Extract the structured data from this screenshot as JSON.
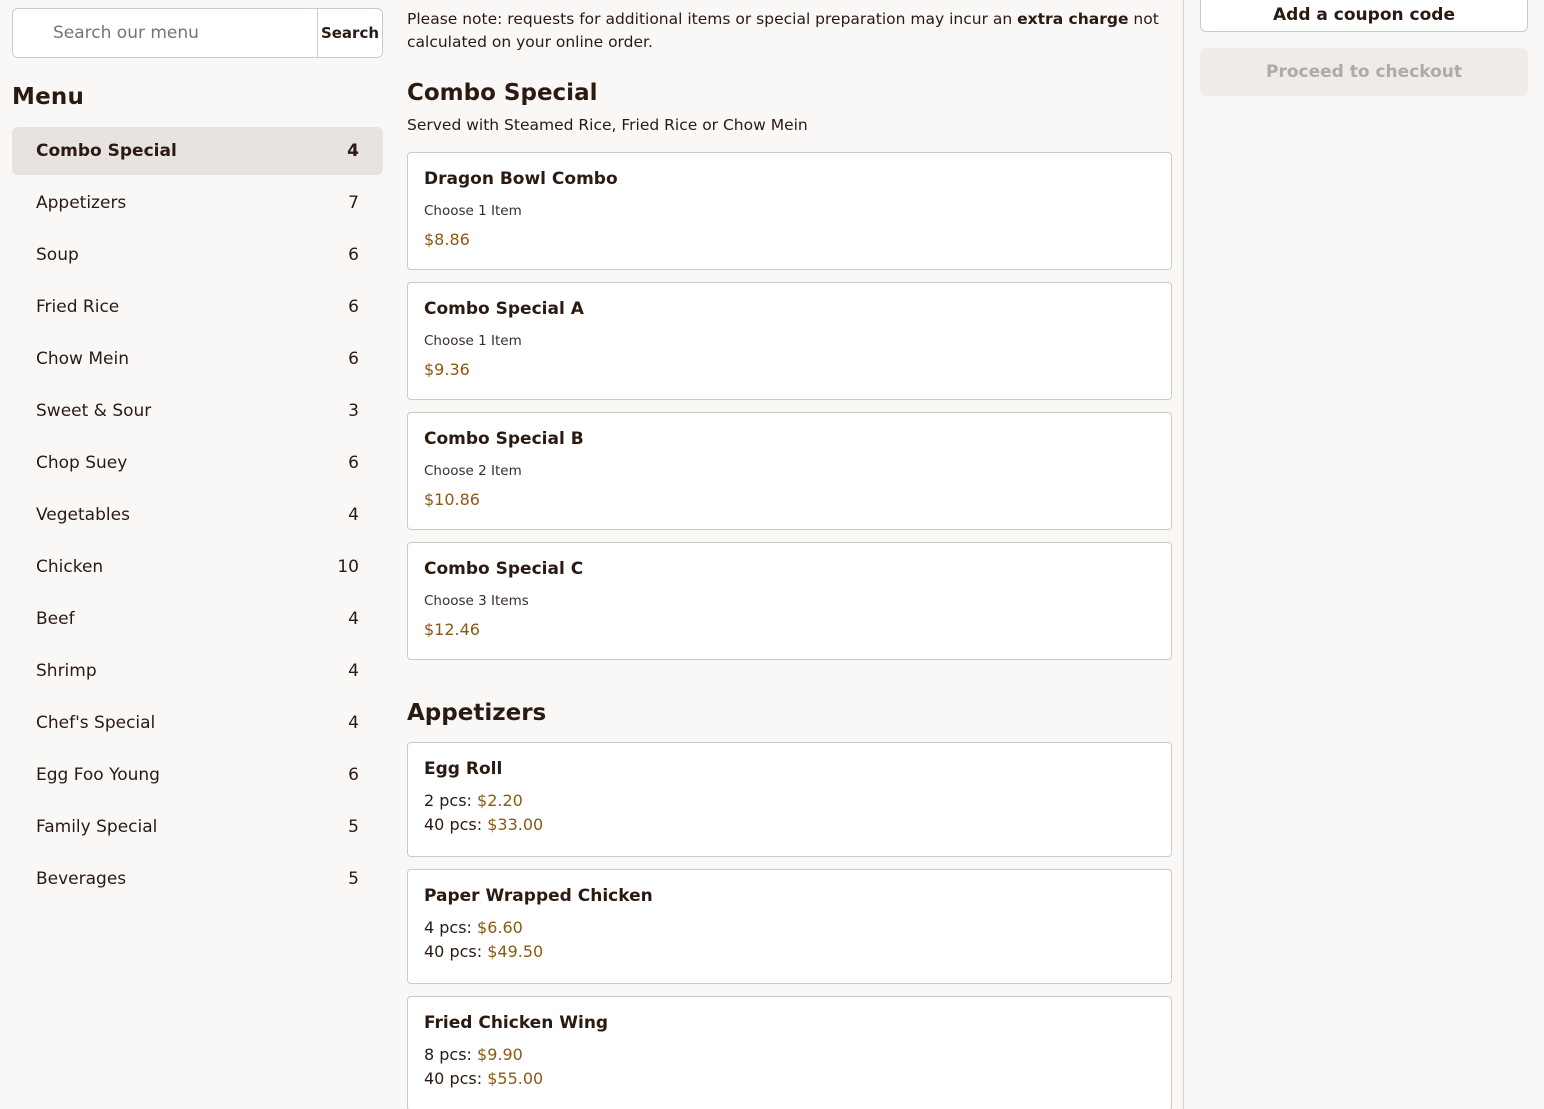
{
  "search": {
    "placeholder": "Search our menu",
    "button_label": "Search"
  },
  "sidebar": {
    "title": "Menu",
    "categories": [
      {
        "label": "Combo Special",
        "count": "4",
        "active": true
      },
      {
        "label": "Appetizers",
        "count": "7"
      },
      {
        "label": "Soup",
        "count": "6"
      },
      {
        "label": "Fried Rice",
        "count": "6"
      },
      {
        "label": "Chow Mein",
        "count": "6"
      },
      {
        "label": "Sweet & Sour",
        "count": "3"
      },
      {
        "label": "Chop Suey",
        "count": "6"
      },
      {
        "label": "Vegetables",
        "count": "4"
      },
      {
        "label": "Chicken",
        "count": "10"
      },
      {
        "label": "Beef",
        "count": "4"
      },
      {
        "label": "Shrimp",
        "count": "4"
      },
      {
        "label": "Chef's Special",
        "count": "4"
      },
      {
        "label": "Egg Foo Young",
        "count": "6"
      },
      {
        "label": "Family Special",
        "count": "5"
      },
      {
        "label": "Beverages",
        "count": "5"
      }
    ]
  },
  "notice": {
    "prefix": "Please note: requests for additional items or special preparation may incur an ",
    "emphasis": "extra charge",
    "suffix": " not calculated on your online order."
  },
  "sections": {
    "combo": {
      "title": "Combo Special",
      "subtitle": "Served with Steamed Rice, Fried Rice or Chow Mein",
      "items": [
        {
          "name": "Dragon Bowl Combo",
          "choose": "Choose 1 Item",
          "price": "$8.86"
        },
        {
          "name": "Combo Special A",
          "choose": "Choose 1 Item",
          "price": "$9.36"
        },
        {
          "name": "Combo Special B",
          "choose": "Choose 2 Item",
          "price": "$10.86"
        },
        {
          "name": "Combo Special C",
          "choose": "Choose 3 Items",
          "price": "$12.46"
        }
      ]
    },
    "appetizers": {
      "title": "Appetizers",
      "items": [
        {
          "name": "Egg Roll",
          "prices": [
            {
              "qty": "2 pcs:",
              "amount": "$2.20"
            },
            {
              "qty": "40 pcs:",
              "amount": "$33.00"
            }
          ]
        },
        {
          "name": "Paper Wrapped Chicken",
          "prices": [
            {
              "qty": "4 pcs:",
              "amount": "$6.60"
            },
            {
              "qty": "40 pcs:",
              "amount": "$49.50"
            }
          ]
        },
        {
          "name": "Fried Chicken Wing",
          "prices": [
            {
              "qty": "8 pcs:",
              "amount": "$9.90"
            },
            {
              "qty": "40 pcs:",
              "amount": "$55.00"
            }
          ]
        }
      ]
    }
  },
  "cart": {
    "coupon_label": "Add a coupon code",
    "checkout_label": "Proceed to checkout"
  }
}
